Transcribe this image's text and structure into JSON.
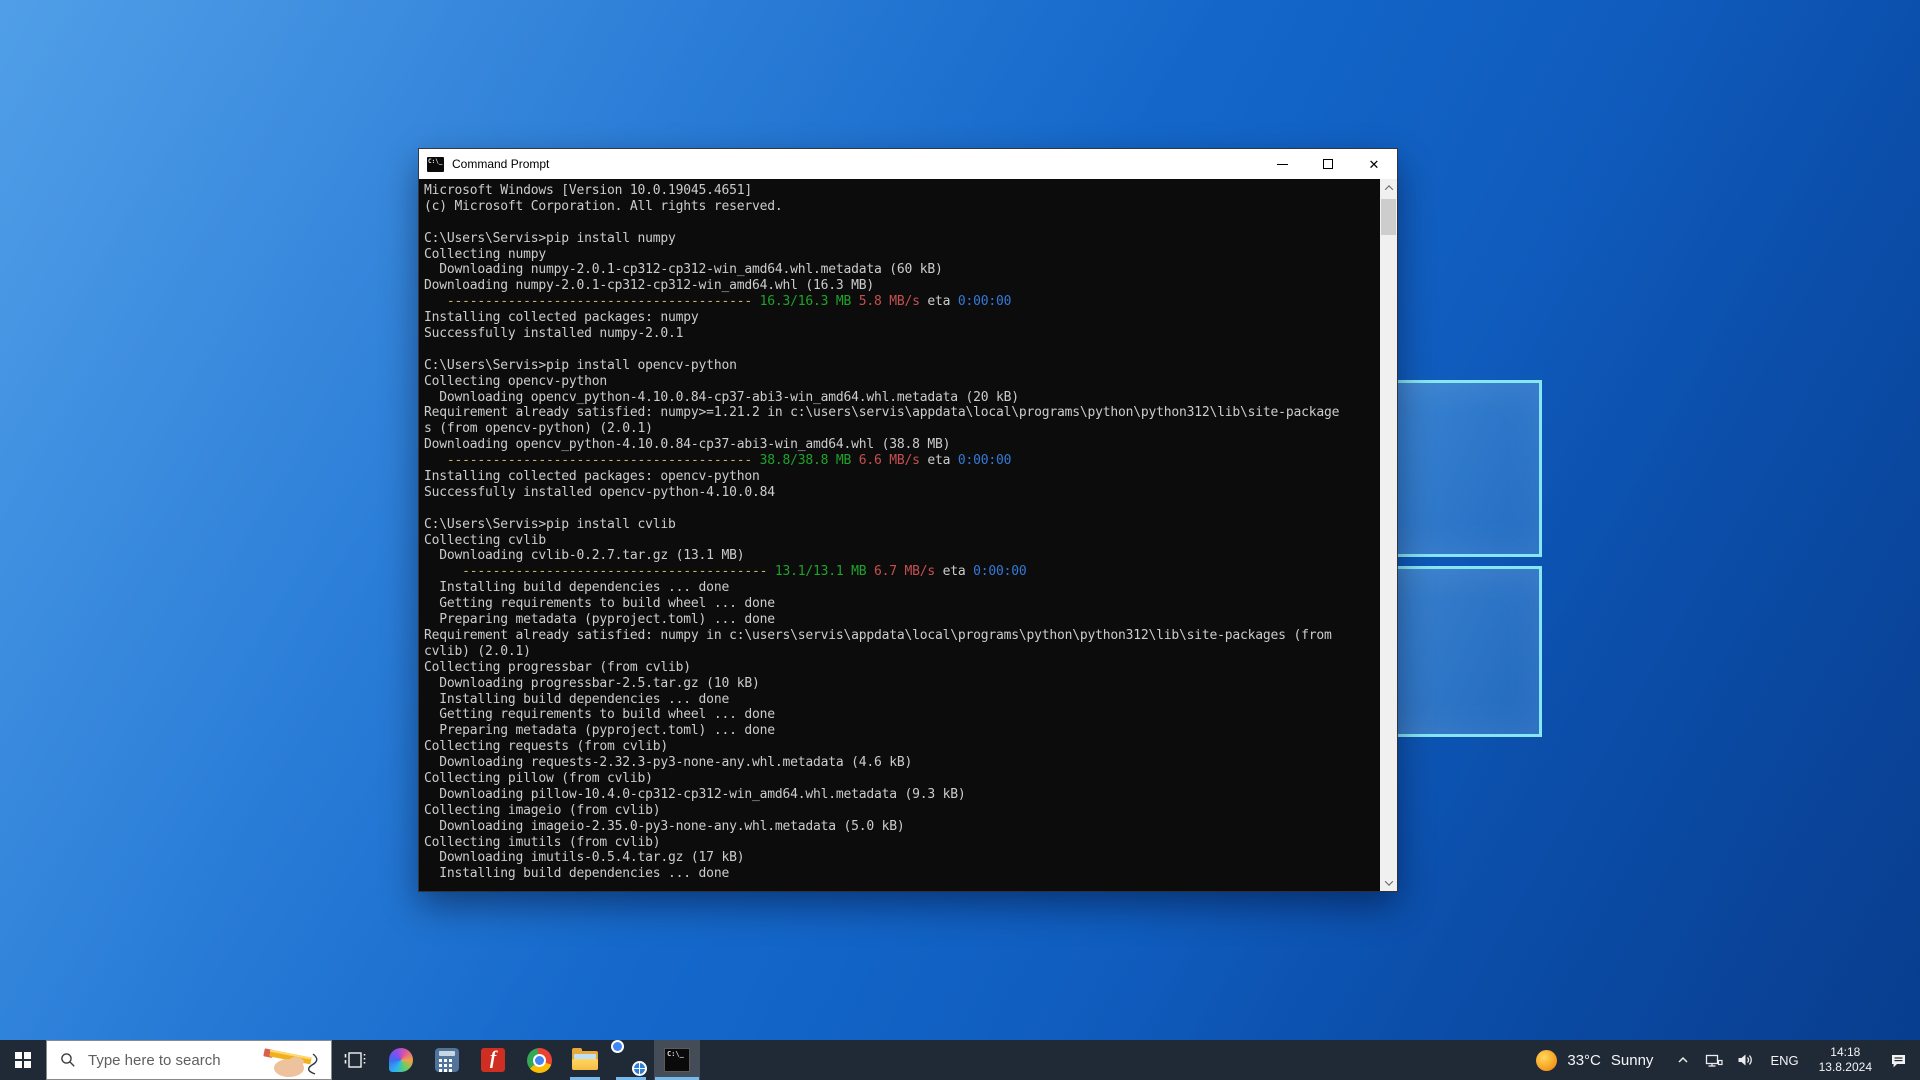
{
  "window": {
    "title": "Command Prompt",
    "icon_glyph": "C:\\_",
    "controls": [
      {
        "name": "minimize"
      },
      {
        "name": "maximize"
      },
      {
        "name": "close"
      }
    ]
  },
  "terminal": {
    "colors": {
      "d": "#cccccc",
      "y": "#c3b65f",
      "g": "#1fa32b",
      "r": "#c65050",
      "b": "#3579d8"
    },
    "lines": [
      [
        [
          "d",
          "Microsoft Windows [Version 10.0.19045.4651]"
        ]
      ],
      [
        [
          "d",
          "(c) Microsoft Corporation. All rights reserved."
        ]
      ],
      [
        [
          "d",
          ""
        ]
      ],
      [
        [
          "d",
          "C:\\Users\\Servis>pip install numpy"
        ]
      ],
      [
        [
          "d",
          "Collecting numpy"
        ]
      ],
      [
        [
          "d",
          "  Downloading numpy-2.0.1-cp312-cp312-win_amd64.whl.metadata (60 kB)"
        ]
      ],
      [
        [
          "d",
          "Downloading numpy-2.0.1-cp312-cp312-win_amd64.whl (16.3 MB)"
        ]
      ],
      [
        [
          "d",
          "   "
        ],
        [
          "y",
          "---------------------------------------- "
        ],
        [
          "g",
          "16.3/16.3 MB "
        ],
        [
          "r",
          "5.8 MB/s "
        ],
        [
          "d",
          "eta "
        ],
        [
          "b",
          "0:00:00"
        ]
      ],
      [
        [
          "d",
          "Installing collected packages: numpy"
        ]
      ],
      [
        [
          "d",
          "Successfully installed numpy-2.0.1"
        ]
      ],
      [
        [
          "d",
          ""
        ]
      ],
      [
        [
          "d",
          "C:\\Users\\Servis>pip install opencv-python"
        ]
      ],
      [
        [
          "d",
          "Collecting opencv-python"
        ]
      ],
      [
        [
          "d",
          "  Downloading opencv_python-4.10.0.84-cp37-abi3-win_amd64.whl.metadata (20 kB)"
        ]
      ],
      [
        [
          "d",
          "Requirement already satisfied: numpy>=1.21.2 in c:\\users\\servis\\appdata\\local\\programs\\python\\python312\\lib\\site-package"
        ]
      ],
      [
        [
          "d",
          "s (from opencv-python) (2.0.1)"
        ]
      ],
      [
        [
          "d",
          "Downloading opencv_python-4.10.0.84-cp37-abi3-win_amd64.whl (38.8 MB)"
        ]
      ],
      [
        [
          "d",
          "   "
        ],
        [
          "y",
          "---------------------------------------- "
        ],
        [
          "g",
          "38.8/38.8 MB "
        ],
        [
          "r",
          "6.6 MB/s "
        ],
        [
          "d",
          "eta "
        ],
        [
          "b",
          "0:00:00"
        ]
      ],
      [
        [
          "d",
          "Installing collected packages: opencv-python"
        ]
      ],
      [
        [
          "d",
          "Successfully installed opencv-python-4.10.0.84"
        ]
      ],
      [
        [
          "d",
          ""
        ]
      ],
      [
        [
          "d",
          "C:\\Users\\Servis>pip install cvlib"
        ]
      ],
      [
        [
          "d",
          "Collecting cvlib"
        ]
      ],
      [
        [
          "d",
          "  Downloading cvlib-0.2.7.tar.gz (13.1 MB)"
        ]
      ],
      [
        [
          "d",
          "     "
        ],
        [
          "y",
          "---------------------------------------- "
        ],
        [
          "g",
          "13.1/13.1 MB "
        ],
        [
          "r",
          "6.7 MB/s "
        ],
        [
          "d",
          "eta "
        ],
        [
          "b",
          "0:00:00"
        ]
      ],
      [
        [
          "d",
          "  Installing build dependencies ... done"
        ]
      ],
      [
        [
          "d",
          "  Getting requirements to build wheel ... done"
        ]
      ],
      [
        [
          "d",
          "  Preparing metadata (pyproject.toml) ... done"
        ]
      ],
      [
        [
          "d",
          "Requirement already satisfied: numpy in c:\\users\\servis\\appdata\\local\\programs\\python\\python312\\lib\\site-packages (from"
        ]
      ],
      [
        [
          "d",
          "cvlib) (2.0.1)"
        ]
      ],
      [
        [
          "d",
          "Collecting progressbar (from cvlib)"
        ]
      ],
      [
        [
          "d",
          "  Downloading progressbar-2.5.tar.gz (10 kB)"
        ]
      ],
      [
        [
          "d",
          "  Installing build dependencies ... done"
        ]
      ],
      [
        [
          "d",
          "  Getting requirements to build wheel ... done"
        ]
      ],
      [
        [
          "d",
          "  Preparing metadata (pyproject.toml) ... done"
        ]
      ],
      [
        [
          "d",
          "Collecting requests (from cvlib)"
        ]
      ],
      [
        [
          "d",
          "  Downloading requests-2.32.3-py3-none-any.whl.metadata (4.6 kB)"
        ]
      ],
      [
        [
          "d",
          "Collecting pillow (from cvlib)"
        ]
      ],
      [
        [
          "d",
          "  Downloading pillow-10.4.0-cp312-cp312-win_amd64.whl.metadata (9.3 kB)"
        ]
      ],
      [
        [
          "d",
          "Collecting imageio (from cvlib)"
        ]
      ],
      [
        [
          "d",
          "  Downloading imageio-2.35.0-py3-none-any.whl.metadata (5.0 kB)"
        ]
      ],
      [
        [
          "d",
          "Collecting imutils (from cvlib)"
        ]
      ],
      [
        [
          "d",
          "  Downloading imutils-0.5.4.tar.gz (17 kB)"
        ]
      ],
      [
        [
          "d",
          "  Installing build dependencies ... done"
        ]
      ]
    ]
  },
  "taskbar": {
    "search_placeholder": "Type here to search",
    "pinned_apps": [
      "task-view",
      "copilot",
      "calculator",
      "f-app",
      "chrome",
      "file-explorer",
      "chrome-profile",
      "command-prompt"
    ],
    "running_apps": [
      "file-explorer",
      "chrome-profile",
      "command-prompt"
    ],
    "active_app": "command-prompt",
    "cmd_icon_glyph": "C:\\_",
    "f_glyph": "f",
    "tray": {
      "weather_temp": "33°C",
      "weather_condition": "Sunny",
      "language": "ENG",
      "time": "14:18",
      "date": "13.8.2024"
    }
  },
  "icons": {
    "start": "windows-logo",
    "search": "magnifier",
    "search_art": "hand-with-pencil",
    "tray": [
      "sun",
      "chevron-up",
      "network",
      "volume",
      "action-center"
    ]
  },
  "colors": {
    "taskbar_bg": "#202a37",
    "taskbar_underline": "#76b9ed",
    "titlebar_bg": "#ffffff",
    "terminal_bg": "#0c0c0c",
    "wallpaper_top": "#2f8ce4",
    "wallpaper_bottom": "#0a4aa4",
    "logo_pane_edge": "#86e7f3"
  }
}
